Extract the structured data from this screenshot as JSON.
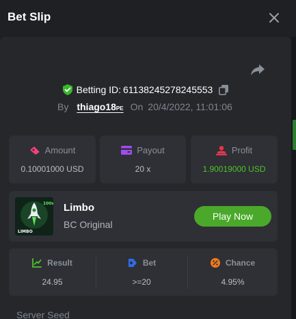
{
  "header": {
    "title": "Bet Slip",
    "close_icon": "close-icon"
  },
  "bet": {
    "id_label": "Betting ID:",
    "id_value": "61138245278245553",
    "by_label": "By",
    "user_name": "thiago18",
    "user_suffix": "PE",
    "on_label": "On",
    "date": "20/4/2022, 11:01:06"
  },
  "stats": [
    {
      "label": "Amount",
      "value": "0.10001000 USD",
      "icon": "amount-icon"
    },
    {
      "label": "Payout",
      "value": "20 x",
      "icon": "payout-icon"
    },
    {
      "label": "Profit",
      "value": "1.90019000 USD",
      "icon": "profit-icon"
    }
  ],
  "game": {
    "name": "Limbo",
    "subtitle": "BC Original",
    "play_label": "Play Now",
    "thumb_label": "LIMBO",
    "thumb_multiplier": "100x"
  },
  "results": [
    {
      "label": "Result",
      "value": "24.95",
      "icon": "result-icon"
    },
    {
      "label": "Bet",
      "value": ">=20",
      "icon": "bet-icon"
    },
    {
      "label": "Chance",
      "value": "4.95%",
      "icon": "chance-icon"
    }
  ],
  "seed": {
    "label": "Server Seed"
  },
  "colors": {
    "accent": "#4aa92a",
    "profit": "#4fc32a",
    "amount_icon": "#f0427a",
    "payout_icon": "#a24cf0",
    "profit_icon": "#e8364a",
    "bet_icon": "#2f6be8",
    "chance_icon": "#f07a1a"
  }
}
